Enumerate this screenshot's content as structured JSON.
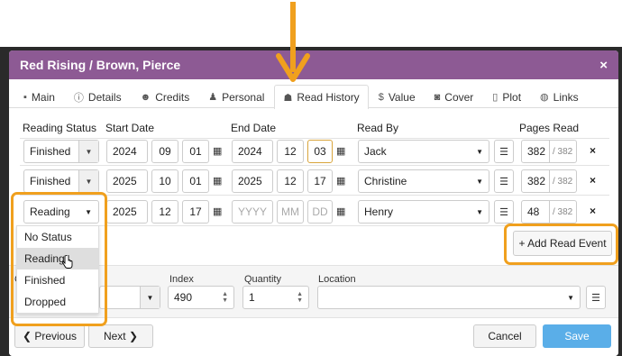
{
  "modal": {
    "title": "Red Rising / Brown, Pierce",
    "close": "×"
  },
  "tabs": [
    {
      "label": "Main",
      "icon": "book-icon",
      "glyph": "▪"
    },
    {
      "label": "Details",
      "icon": "info-icon",
      "glyph": "ⓘ"
    },
    {
      "label": "Credits",
      "icon": "users-icon",
      "glyph": "☻"
    },
    {
      "label": "Personal",
      "icon": "user-icon",
      "glyph": "♟"
    },
    {
      "label": "Read History",
      "icon": "reader-icon",
      "glyph": "☗",
      "active": true
    },
    {
      "label": "Value",
      "icon": "dollar-icon",
      "glyph": "$"
    },
    {
      "label": "Cover",
      "icon": "camera-icon",
      "glyph": "◙"
    },
    {
      "label": "Plot",
      "icon": "file-icon",
      "glyph": "▯"
    },
    {
      "label": "Links",
      "icon": "globe-icon",
      "glyph": "◍"
    }
  ],
  "grid": {
    "headers": {
      "status": "Reading Status",
      "start": "Start Date",
      "end": "End Date",
      "read_by": "Read By",
      "pages": "Pages Read"
    },
    "rows": [
      {
        "status": "Finished",
        "sy": "2024",
        "sm": "09",
        "sd": "01",
        "ey": "2024",
        "em": "12",
        "ed": "03",
        "read_by": "Jack",
        "pages": "382",
        "max": "/ 382"
      },
      {
        "status": "Finished",
        "sy": "2025",
        "sm": "10",
        "sd": "01",
        "ey": "2025",
        "em": "12",
        "ed": "17",
        "read_by": "Christine",
        "pages": "382",
        "max": "/ 382"
      },
      {
        "status": "Reading",
        "sy": "2025",
        "sm": "12",
        "sd": "17",
        "ey_ph": "YYYY",
        "em_ph": "MM",
        "ed_ph": "DD",
        "read_by": "Henry",
        "pages": "48",
        "max": "/ 382"
      }
    ],
    "delete_glyph": "×",
    "calendar_glyph": "▦",
    "list_glyph": "☰"
  },
  "add_read_event": "+ Add Read Event",
  "dropdown": {
    "options": [
      "No Status",
      "Reading",
      "Finished",
      "Dropped"
    ],
    "hovered": "Reading"
  },
  "bottom": {
    "partial_label": "C",
    "index_label": "Index",
    "index_value": "490",
    "quantity_label": "Quantity",
    "quantity_value": "1",
    "location_label": "Location"
  },
  "footer": {
    "previous": "❮ Previous",
    "next": "Next ❯",
    "cancel": "Cancel",
    "save": "Save"
  },
  "colors": {
    "header": "#8d5a94",
    "annotation": "#f0a01e",
    "save": "#5aaee8"
  }
}
